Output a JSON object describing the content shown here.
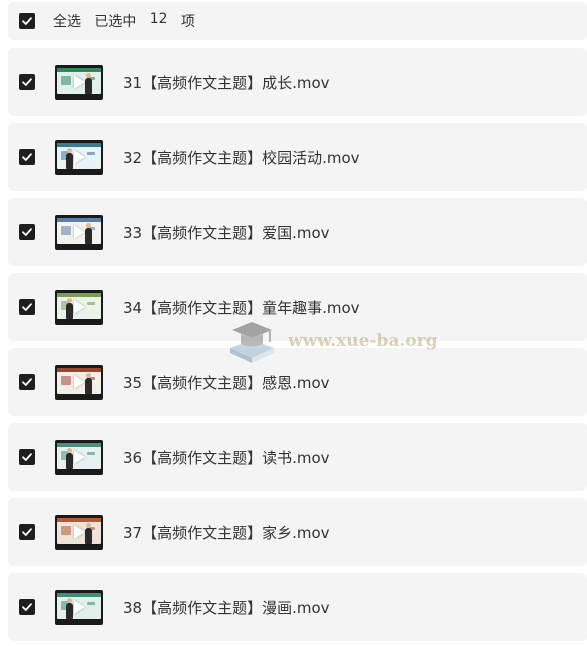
{
  "header": {
    "select_all": "全选",
    "selected_prefix": "已选中",
    "count": "12",
    "unit": "项"
  },
  "items": [
    {
      "title": "31【高频作文主题】成长.mov",
      "screen": "#dff1ea",
      "accent": "#2e8b57"
    },
    {
      "title": "32【高频作文主题】校园活动.mov",
      "screen": "#e8f3f7",
      "accent": "#3d7a8f"
    },
    {
      "title": "33【高频作文主题】爱国.mov",
      "screen": "#f2f2ee",
      "accent": "#5c7fa8"
    },
    {
      "title": "34【高频作文主题】童年趣事.mov",
      "screen": "#eaf3ea",
      "accent": "#7a9f52"
    },
    {
      "title": "35【高频作文主题】感恩.mov",
      "screen": "#f3efe4",
      "accent": "#a0442e"
    },
    {
      "title": "36【高频作文主题】读书.mov",
      "screen": "#e6f2ef",
      "accent": "#4e8f7d"
    },
    {
      "title": "37【高频作文主题】家乡.mov",
      "screen": "#f0e4d8",
      "accent": "#b45a3a"
    },
    {
      "title": "38【高频作文主题】漫画.mov",
      "screen": "#e2f0ec",
      "accent": "#3f8d7a"
    }
  ],
  "watermark": {
    "text": "www.xue-ba.org",
    "icon": "graduation-cap-book-icon"
  },
  "colors": {
    "row_bg": "#f4f4f4",
    "checkbox": "#1e1e1e",
    "text": "#333333"
  }
}
